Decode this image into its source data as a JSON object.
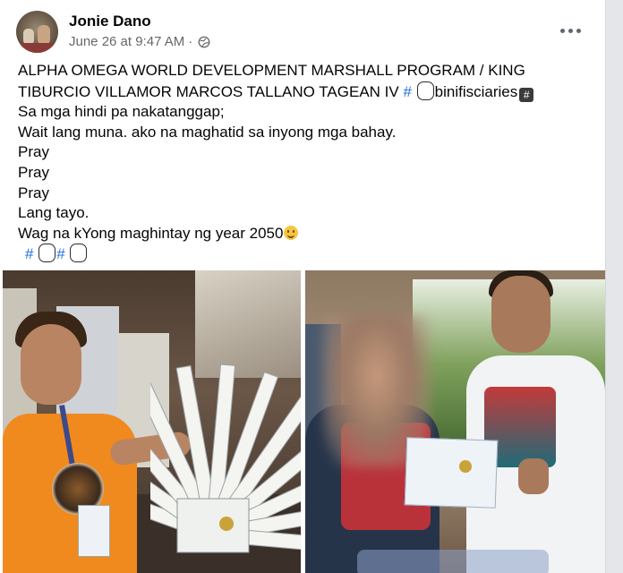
{
  "post": {
    "author": "Jonie Dano",
    "timestamp": "June 26 at 9:47 AM",
    "separator": "·",
    "privacy_icon": "globe-icon",
    "more_icon": "more-horizontal-icon",
    "lines": {
      "l1": "ALPHA OMEGA WORLD DEVELOPMENT MARSHALL PROGRAM  / KING",
      "l2_text": "TIBURCIO VILLAMOR MARCOS TALLANO TAGEAN IV",
      "l2_hash": "#",
      "l2_tail": "binifisciaries",
      "l2_tag": "#",
      "l3": "Sa mga hindi pa nakatanggap;",
      "l4": "Wait lang muna. ako na maghatid sa inyong mga bahay.",
      "l5": "Pray",
      "l6": "Pray",
      "l7": "Pray",
      "l8": "Lang tayo.",
      "l9": "Wag na kYong maghintay ng year 2050",
      "l10_hash1": "#",
      "l10_hash2": "#"
    }
  },
  "colors": {
    "link": "#216fdb",
    "text": "#050505",
    "meta": "#65676b"
  }
}
